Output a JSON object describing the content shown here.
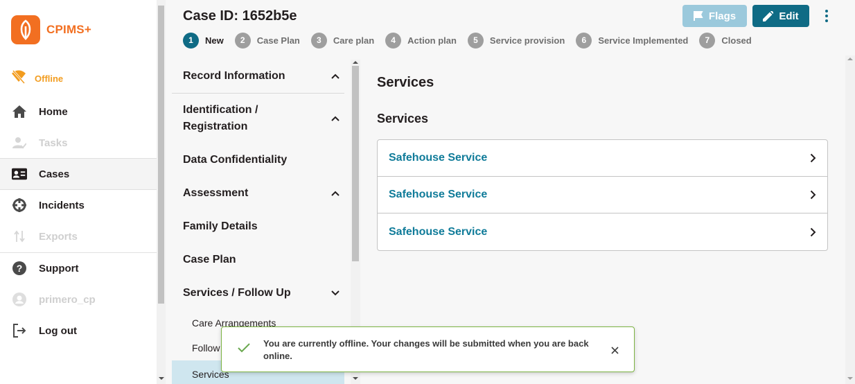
{
  "app": {
    "name": "CPIMS+",
    "brand_color": "#f26f21"
  },
  "status": {
    "offline_label": "Offline",
    "offline_color": "#f29c1f"
  },
  "nav": {
    "items": [
      {
        "label": "Home",
        "icon": "home-icon"
      },
      {
        "label": "Tasks",
        "icon": "tasks-icon",
        "disabled": true
      },
      {
        "label": "Cases",
        "icon": "cases-icon",
        "active": true
      },
      {
        "label": "Incidents",
        "icon": "incidents-icon"
      },
      {
        "label": "Exports",
        "icon": "exports-icon",
        "disabled": true
      },
      {
        "label": "Support",
        "icon": "support-icon"
      },
      {
        "label": "primero_cp",
        "icon": "user-icon",
        "disabled": true
      },
      {
        "label": "Log out",
        "icon": "logout-icon"
      }
    ]
  },
  "header": {
    "case_title": "Case ID: 1652b5e",
    "flags_label": "Flags",
    "edit_label": "Edit",
    "accent_color": "#0f6b85"
  },
  "stepper": [
    {
      "num": "1",
      "label": "New",
      "active": true
    },
    {
      "num": "2",
      "label": "Case Plan"
    },
    {
      "num": "3",
      "label": "Care plan"
    },
    {
      "num": "4",
      "label": "Action plan"
    },
    {
      "num": "5",
      "label": "Service provision"
    },
    {
      "num": "6",
      "label": "Service Implemented"
    },
    {
      "num": "7",
      "label": "Closed"
    }
  ],
  "record_sections": {
    "groups": [
      "Record Information",
      "Identification / Registration",
      "Data Confidentiality",
      "Assessment",
      "Family Details",
      "Case Plan",
      "Services / Follow Up"
    ],
    "sub_items": [
      "Care Arrangements",
      "Follow",
      "Services"
    ]
  },
  "form": {
    "title": "Services",
    "subtitle": "Services",
    "services": [
      "Safehouse Service",
      "Safehouse Service",
      "Safehouse Service"
    ]
  },
  "snackbar": {
    "message": "You are currently offline. Your changes will be submitted when you are back online."
  }
}
